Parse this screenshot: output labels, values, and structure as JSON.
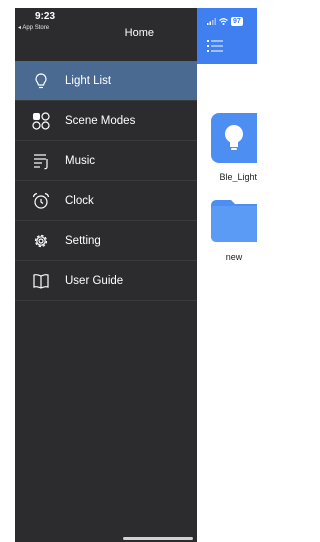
{
  "status": {
    "time": "9:23",
    "back_app": "◂ App Store",
    "battery": "97"
  },
  "drawer": {
    "title": "Home",
    "items": [
      {
        "label": "Light List",
        "icon": "lightbulb-icon",
        "active": true
      },
      {
        "label": "Scene Modes",
        "icon": "scene-modes-icon",
        "active": false
      },
      {
        "label": "Music",
        "icon": "music-icon",
        "active": false
      },
      {
        "label": "Clock",
        "icon": "alarm-clock-icon",
        "active": false
      },
      {
        "label": "Setting",
        "icon": "gear-icon",
        "active": false
      },
      {
        "label": "User Guide",
        "icon": "book-icon",
        "active": false
      }
    ]
  },
  "content": {
    "devices": [
      {
        "label": "Ble_Light",
        "icon": "lightbulb-icon"
      },
      {
        "label": "new",
        "icon": "folder-icon"
      }
    ]
  },
  "colors": {
    "drawer_bg": "#2c2c2e",
    "active_item": "#4a6a92",
    "accent": "#3f7ff0"
  }
}
